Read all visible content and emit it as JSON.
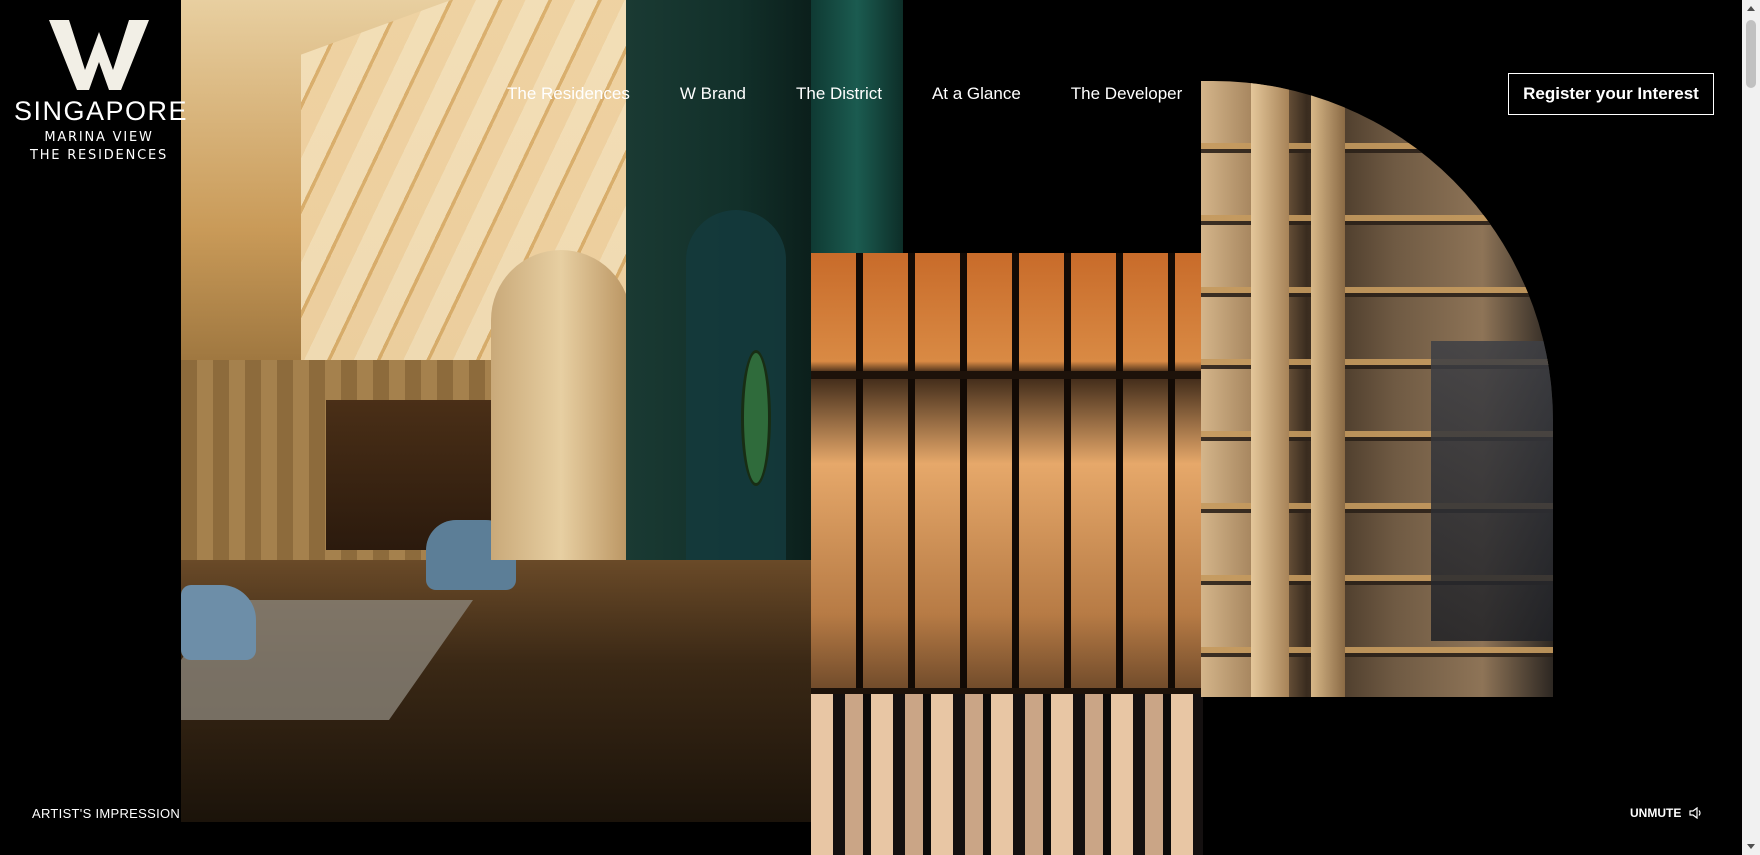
{
  "logo": {
    "mark": "W",
    "city": "SINGAPORE",
    "line1": "MARINA VIEW",
    "line2": "THE RESIDENCES"
  },
  "nav": {
    "items": [
      {
        "label": "The Residences"
      },
      {
        "label": "W Brand"
      },
      {
        "label": "The District"
      },
      {
        "label": "At a Glance"
      },
      {
        "label": "The Developer"
      }
    ],
    "cta_label": "Register your Interest"
  },
  "footer": {
    "caption": "ARTIST'S IMPRESSION",
    "unmute_label": "UNMUTE",
    "unmute_icon": "speaker-icon"
  },
  "colors": {
    "background": "#000000",
    "text": "#ffffff"
  }
}
